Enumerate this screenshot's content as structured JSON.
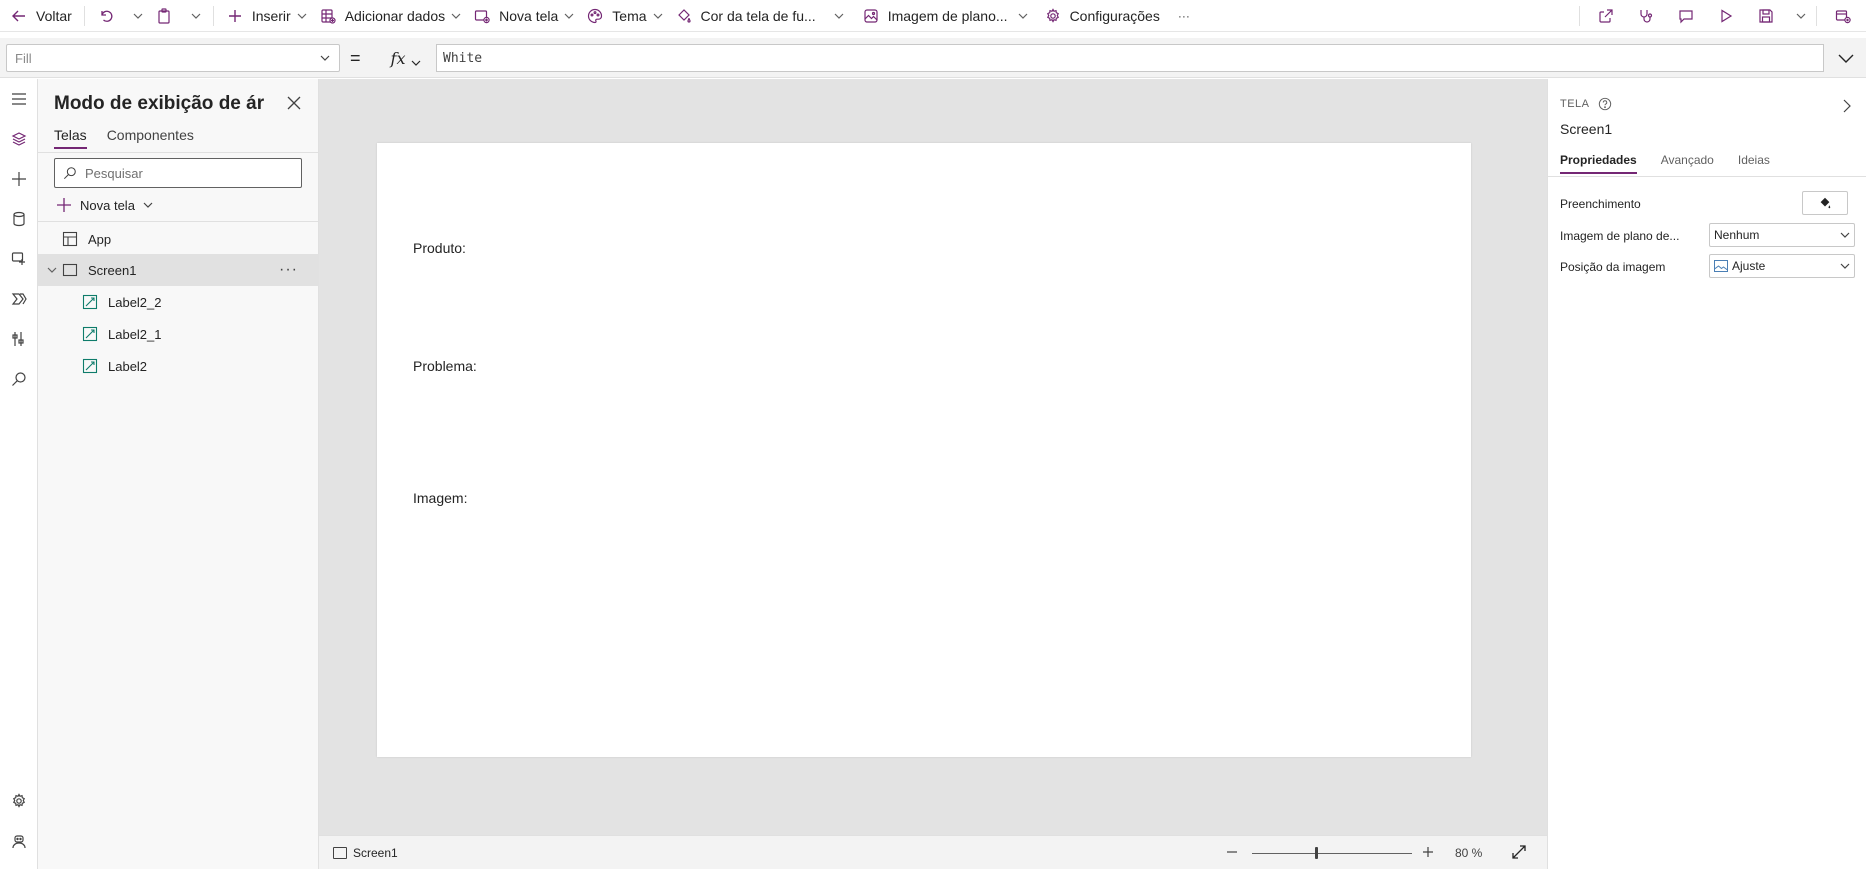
{
  "commandbar": {
    "back_label": "Voltar",
    "insert_label": "Inserir",
    "add_data_label": "Adicionar dados",
    "new_screen_label": "Nova tela",
    "theme_label": "Tema",
    "bg_color_label": "Cor da tela de fu...",
    "bg_image_label": "Imagem de plano...",
    "settings_label": "Configurações",
    "more_label": "···"
  },
  "formulabar": {
    "property": "Fill",
    "equals": "=",
    "fx": "fx",
    "formula": "White"
  },
  "tree": {
    "title": "Modo de exibição de ár...",
    "tabs": [
      "Telas",
      "Componentes"
    ],
    "search_placeholder": "Pesquisar",
    "new_screen_label": "Nova tela",
    "items": [
      {
        "label": "App"
      },
      {
        "label": "Screen1"
      },
      {
        "label": "Label2_2"
      },
      {
        "label": "Label2_1"
      },
      {
        "label": "Label2"
      }
    ]
  },
  "canvas": {
    "labels": [
      "Produto:",
      "Problema:",
      "Imagem:"
    ],
    "background_color": "#ffffff"
  },
  "statusbar": {
    "screen_name": "Screen1",
    "zoom": "80 %",
    "zoom_level": 80
  },
  "properties": {
    "kind": "TELA",
    "name": "Screen1",
    "tabs": [
      "Propriedades",
      "Avançado",
      "Ideias"
    ],
    "fill_label": "Preenchimento",
    "bg_image_label": "Imagem de plano de...",
    "bg_image_value": "Nenhum",
    "image_position_label": "Posição da imagem",
    "image_position_value": "Ajuste"
  },
  "colors": {
    "accent": "#742774",
    "canvas_bg": "#e3e3e3"
  }
}
